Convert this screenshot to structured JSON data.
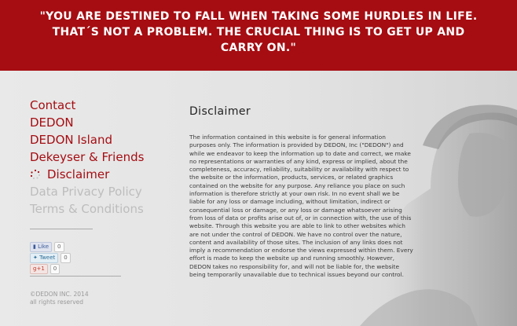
{
  "banner": {
    "quote": "\"YOU ARE DESTINED TO FALL WHEN TAKING SOME HURDLES IN LIFE. THAT´S NOT A PROBLEM. THE CRUCIAL THING IS TO GET UP AND CARRY ON.\""
  },
  "nav": {
    "items": [
      {
        "label": "Contact",
        "state": "link"
      },
      {
        "label": "DEDON",
        "state": "link"
      },
      {
        "label": "DEDON Island",
        "state": "link"
      },
      {
        "label": "Dekeyser & Friends",
        "state": "link"
      },
      {
        "label": "Disclaimer",
        "state": "active"
      },
      {
        "label": "Data Privacy Policy",
        "state": "muted"
      },
      {
        "label": "Terms & Conditions",
        "state": "muted"
      }
    ]
  },
  "social": {
    "like_label": "Like",
    "like_count": "0",
    "tweet_label": "Tweet",
    "tweet_count": "0",
    "gplus_label": "+1",
    "gplus_count": "0"
  },
  "footer": {
    "copyright": "©DEDON INC. 2014",
    "rights": "all rights reserved"
  },
  "main": {
    "heading": "Disclaimer",
    "body": "The information contained in this website is for general information purposes only. The information is provided by DEDON, Inc (\"DEDON\") and while we endeavor to keep the information up to date and correct, we make no representations or warranties of any kind, express or implied, about the completeness, accuracy, reliability, suitability or availability with respect to the website or the information, products, services, or related graphics contained on the website for any purpose. Any reliance you place on such information is therefore strictly at your own risk. In no event shall we be liable for any loss or damage including, without limitation, indirect or consequential loss or damage, or any loss or damage whatsoever arising from loss of data or profits arise out of, or in connection with, the use of this website. Through this website you are able to link to other websites which are not under the control of DEDON. We have no control over the nature, content and availability of those sites. The inclusion of any links does not imply a recommendation or endorse the views expressed within them. Every effort is made to keep the website up and running smoothly. However, DEDON takes no responsibility for, and will not be liable for, the website being temporarily unavailable due to technical issues beyond our control."
  },
  "colors": {
    "brand_red": "#a50d12",
    "muted_nav": "#bdbdbd",
    "background": "#e4e4e4"
  },
  "icons": {
    "active_marker": "sun-dots-icon"
  }
}
